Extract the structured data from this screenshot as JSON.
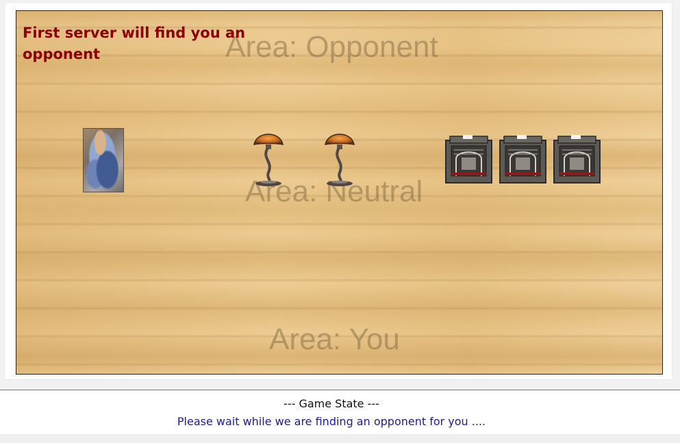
{
  "game": {
    "server_message": "First server will find you an opponent",
    "areas": {
      "opponent": "Area: Opponent",
      "neutral": "Area: Neutral",
      "you": "Area: You"
    },
    "neutral_items": {
      "portrait_card": "woman-with-lute-painting-icon",
      "lamps": [
        "mushroom-lamp-icon",
        "mushroom-lamp-icon"
      ],
      "crates": [
        "ornate-crate-icon",
        "ornate-crate-icon",
        "ornate-crate-icon"
      ]
    }
  },
  "status": {
    "title": "--- Game State ---",
    "message": "Please wait while we are finding an opponent for you ...."
  },
  "colors": {
    "server_message": "#8b0000",
    "status_message": "#1c1c96",
    "area_label": "#785f3c"
  }
}
